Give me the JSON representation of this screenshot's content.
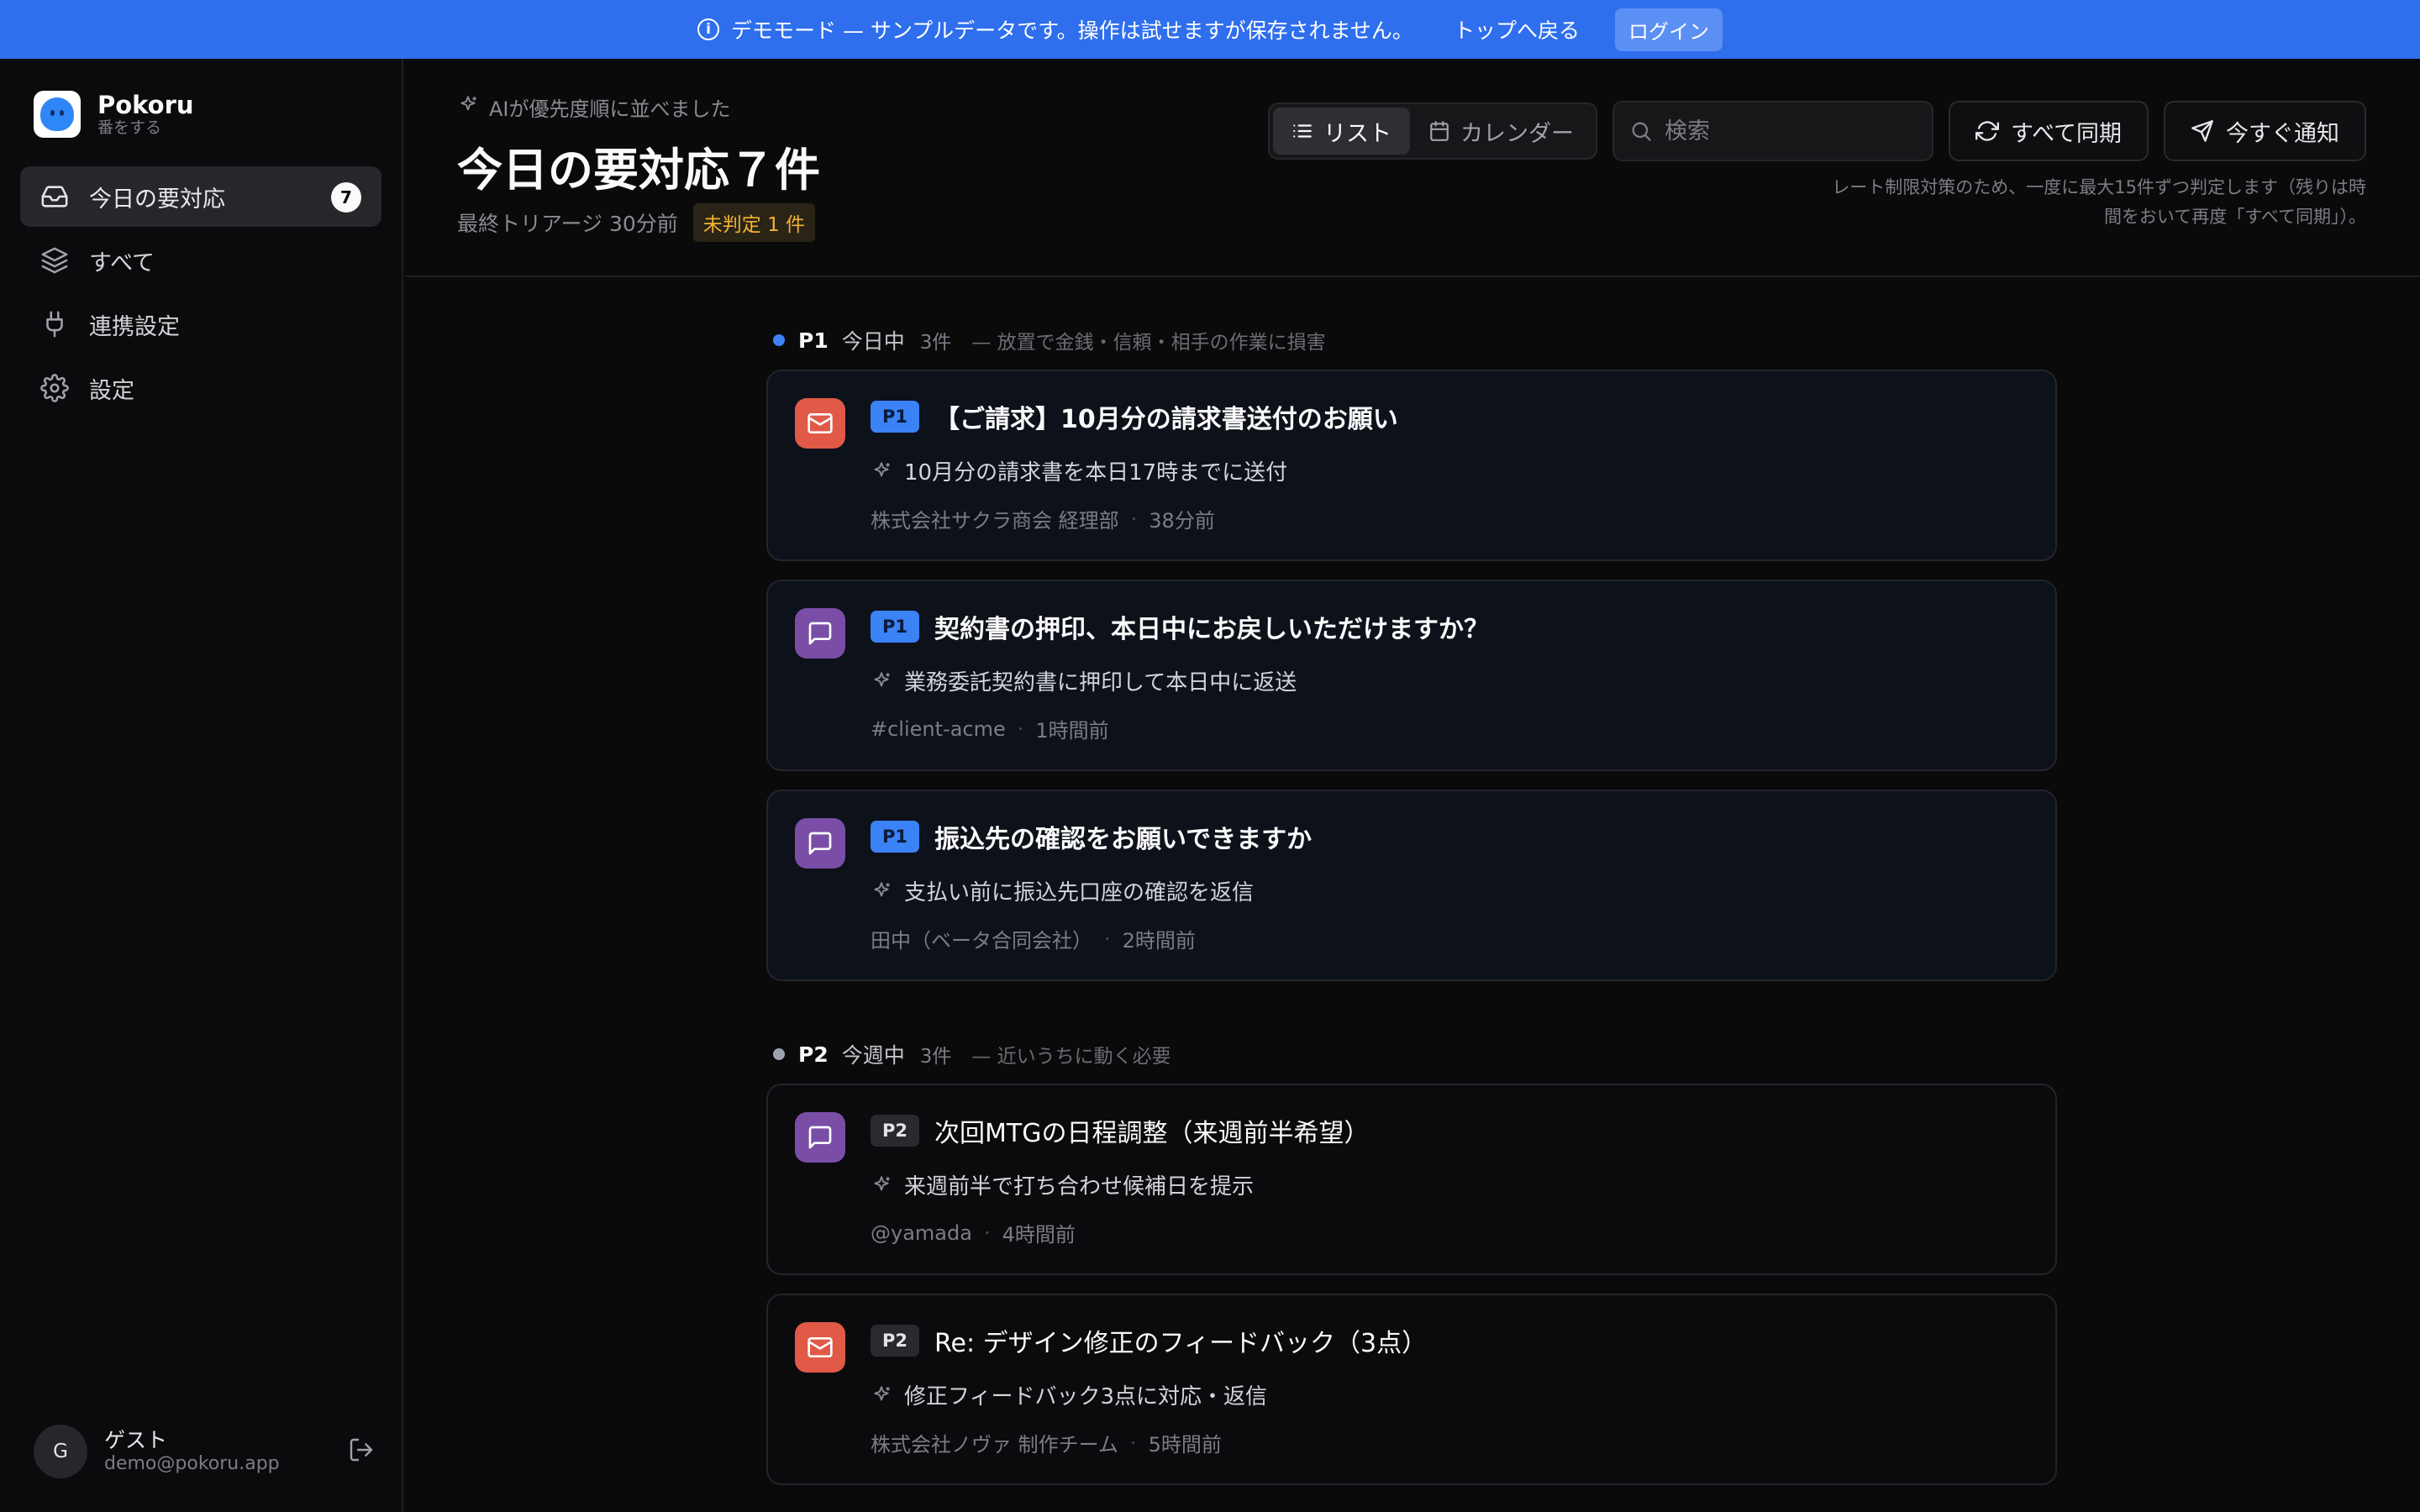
{
  "banner": {
    "text": "デモモード — サンプルデータです。操作は試せますが保存されません。",
    "back_link": "トップへ戻る",
    "login": "ログイン"
  },
  "brand": {
    "name": "Pokoru",
    "sub": "番をする"
  },
  "sidebar": {
    "items": [
      {
        "label": "今日の要対応",
        "badge": "7",
        "icon": "inbox-icon",
        "active": true
      },
      {
        "label": "すべて",
        "icon": "layers-icon"
      },
      {
        "label": "連携設定",
        "icon": "plug-icon"
      },
      {
        "label": "設定",
        "icon": "gear-icon"
      }
    ]
  },
  "user": {
    "initial": "G",
    "name": "ゲスト",
    "email": "demo@pokoru.app"
  },
  "header": {
    "ai_note": "AIが優先度順に並べました",
    "title": "今日の要対応７件",
    "last_triage": "最終トリアージ 30分前",
    "pending": "未判定 1 件",
    "pending_color": "#f3b233"
  },
  "toolbar": {
    "list": "リスト",
    "calendar": "カレンダー",
    "search_placeholder": "検索",
    "sync_all": "すべて同期",
    "notify_now": "今すぐ通知",
    "rate_note": "レート制限対策のため、一度に最大15件ずつ判定します（残りは時間をおいて再度「すべて同期」）。"
  },
  "groups": [
    {
      "code": "P1",
      "label": "今日中",
      "count": "3件",
      "desc": "— 放置で金銭・信頼・相手の作業に損害",
      "dot_color": "#3b82f6",
      "items": [
        {
          "badge": "P1",
          "source": "mail-icon",
          "title": "【ご請求】10月分の請求書送付のお願い",
          "summary": "10月分の請求書を本日17時までに送付",
          "from": "株式会社サクラ商会 経理部",
          "time": "38分前"
        },
        {
          "badge": "P1",
          "source": "chat-icon",
          "title": "契約書の押印、本日中にお戻しいただけますか？",
          "summary": "業務委託契約書に押印して本日中に返送",
          "from": "#client-acme",
          "time": "1時間前"
        },
        {
          "badge": "P1",
          "source": "chat-icon",
          "title": "振込先の確認をお願いできますか",
          "summary": "支払い前に振込先口座の確認を返信",
          "from": "田中（ベータ合同会社）",
          "time": "2時間前"
        }
      ]
    },
    {
      "code": "P2",
      "label": "今週中",
      "count": "3件",
      "desc": "— 近いうちに動く必要",
      "dot_color": "#9ca3af",
      "items": [
        {
          "badge": "P2",
          "source": "chat-icon",
          "title": "次回MTGの日程調整（来週前半希望）",
          "summary": "来週前半で打ち合わせ候補日を提示",
          "from": "@yamada",
          "time": "4時間前"
        },
        {
          "badge": "P2",
          "source": "mail-icon",
          "title": "Re: デザイン修正のフィードバック（3点）",
          "summary": "修正フィードバック3点に対応・返信",
          "from": "株式会社ノヴァ 制作チーム",
          "time": "5時間前"
        }
      ]
    }
  ]
}
